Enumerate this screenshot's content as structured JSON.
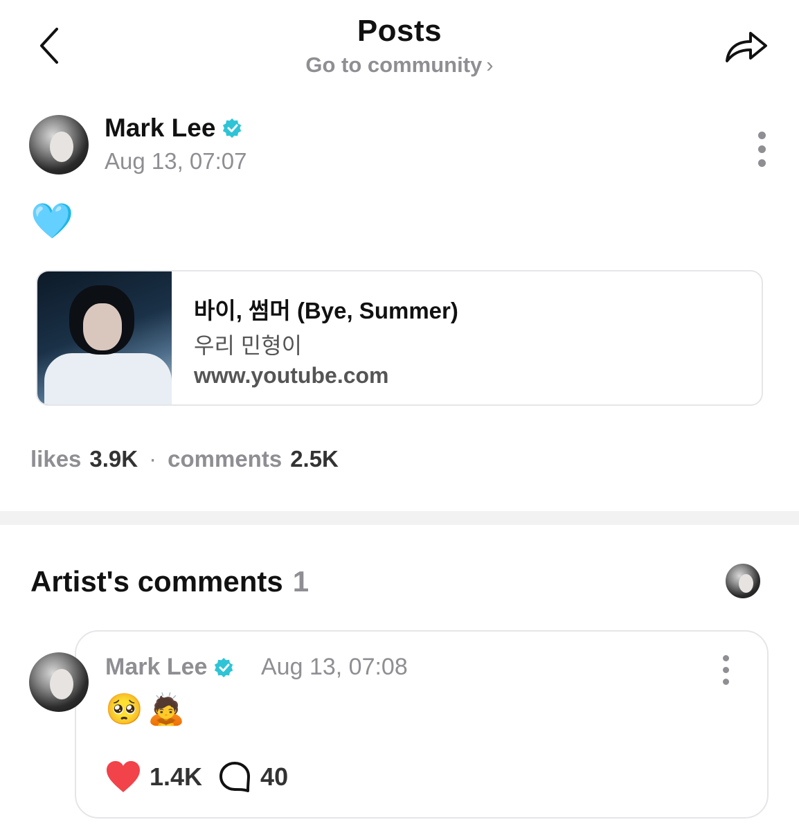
{
  "header": {
    "title": "Posts",
    "community_link": "Go to community",
    "back_icon": "chevron-left-icon",
    "share_icon": "share-arrow-icon"
  },
  "post": {
    "author": "Mark Lee",
    "time": "Aug 13, 07:07",
    "body": "🩵",
    "verified_color": "#2ec4d6",
    "link_card": {
      "title": "바이, 썸머 (Bye, Summer)",
      "subtitle": "우리 민형이",
      "url": "www.youtube.com"
    },
    "stats": {
      "likes_label": "likes",
      "likes_value": "3.9K",
      "separator": "·",
      "comments_label": "comments",
      "comments_value": "2.5K"
    }
  },
  "artist_comments": {
    "title": "Artist's comments",
    "count": "1",
    "items": [
      {
        "author": "Mark Lee",
        "time": "Aug 13, 07:08",
        "body": "🥺🙇",
        "likes": "1.4K",
        "replies": "40",
        "heart_color": "#f2424a"
      }
    ]
  }
}
